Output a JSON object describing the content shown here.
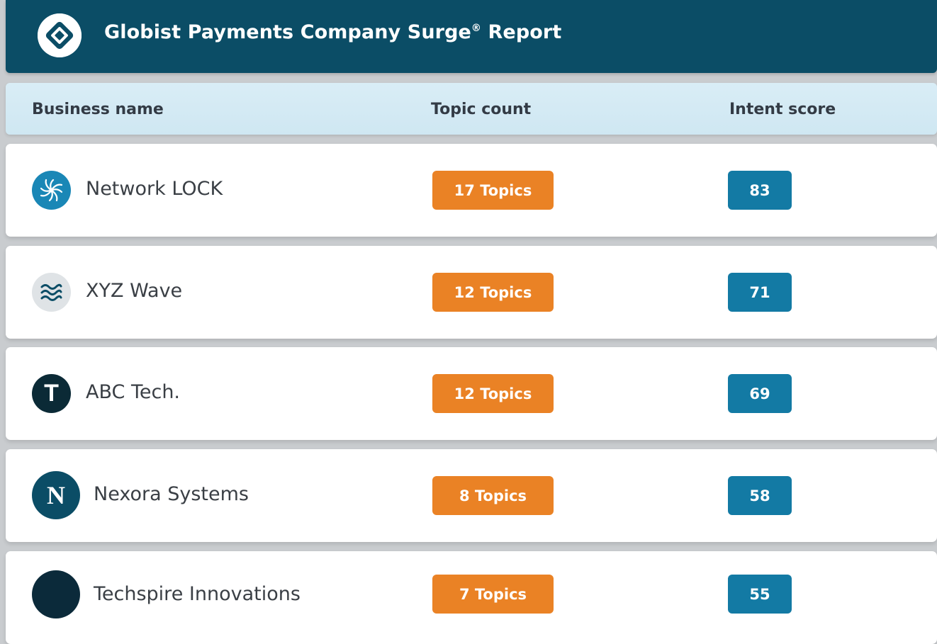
{
  "header": {
    "title": "Globist Payments Company Surge",
    "registered_mark": "®",
    "title_suffix": " Report",
    "logo_icon": "diamond-logo-icon"
  },
  "columns": {
    "business_name": "Business name",
    "topic_count": "Topic count",
    "intent_score": "Intent score"
  },
  "rows": [
    {
      "name": "Network LOCK",
      "topics": "17 Topics",
      "score": "83",
      "icon": "spiral-logo-icon",
      "avatar_color": "#1a87b6"
    },
    {
      "name": "XYZ Wave",
      "topics": "12 Topics",
      "score": "71",
      "icon": "wave-logo-icon",
      "avatar_color": "#dfe3e6"
    },
    {
      "name": "ABC Tech.",
      "topics": "12 Topics",
      "score": "69",
      "icon": "letter-t-logo-icon",
      "avatar_color": "#0b2a36",
      "glyph": "T"
    },
    {
      "name": "Nexora Systems",
      "topics": "8 Topics",
      "score": "58",
      "icon": "letter-n-logo-icon",
      "avatar_color": "#0b4d66",
      "glyph": "N"
    },
    {
      "name": "Techspire Innovations",
      "topics": "7 Topics",
      "score": "55",
      "icon": "dark-circle-logo-icon",
      "avatar_color": "#0b2a3a"
    }
  ],
  "colors": {
    "header_bg": "#0b4d66",
    "column_header_bg": "#d9edf6",
    "topic_pill": "#ea8225",
    "score_pill": "#137aa4"
  }
}
